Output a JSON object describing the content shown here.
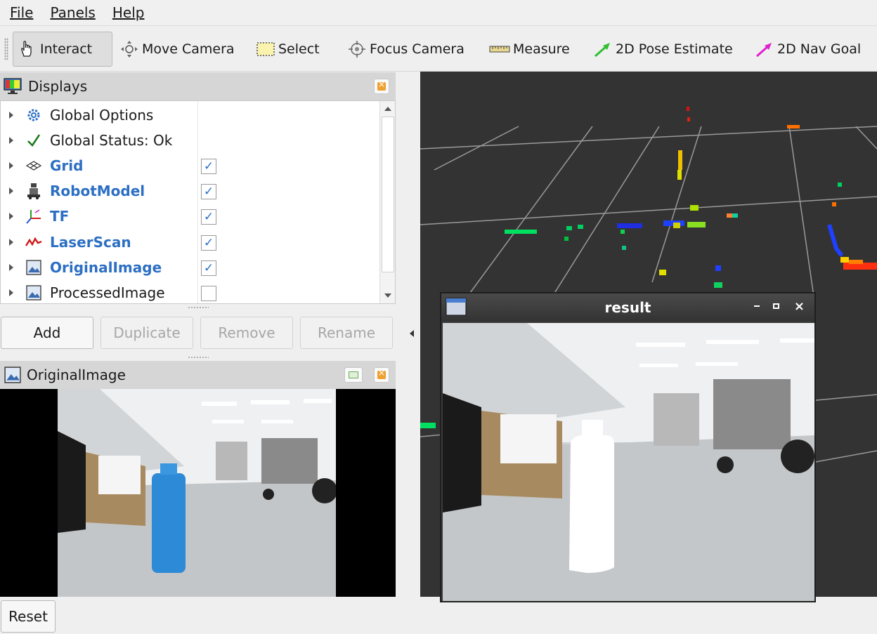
{
  "menubar": {
    "items": [
      "File",
      "Panels",
      "Help"
    ]
  },
  "toolbar": {
    "tools": [
      {
        "label": "Interact",
        "icon": "hand-pointer-icon",
        "active": true
      },
      {
        "label": "Move Camera",
        "icon": "move-camera-icon"
      },
      {
        "label": "Select",
        "icon": "select-box-icon"
      },
      {
        "label": "Focus Camera",
        "icon": "focus-camera-icon"
      },
      {
        "label": "Measure",
        "icon": "ruler-icon"
      },
      {
        "label": "2D Pose Estimate",
        "icon": "green-arrow-icon"
      },
      {
        "label": "2D Nav Goal",
        "icon": "magenta-arrow-icon"
      }
    ]
  },
  "displays": {
    "title": "Displays",
    "items": [
      {
        "label": "Global Options",
        "icon": "gear-icon",
        "highlight": false,
        "checkbox": null
      },
      {
        "label": "Global Status: Ok",
        "icon": "check-icon",
        "highlight": false,
        "checkbox": null
      },
      {
        "label": "Grid",
        "icon": "grid-icon",
        "highlight": true,
        "checkbox": true
      },
      {
        "label": "RobotModel",
        "icon": "robot-icon",
        "highlight": true,
        "checkbox": true
      },
      {
        "label": "TF",
        "icon": "tf-axes-icon",
        "highlight": true,
        "checkbox": true
      },
      {
        "label": "LaserScan",
        "icon": "laser-icon",
        "highlight": true,
        "checkbox": true
      },
      {
        "label": "OriginalImage",
        "icon": "image-icon",
        "highlight": true,
        "checkbox": true
      },
      {
        "label": "ProcessedImage",
        "icon": "image-icon",
        "highlight": false,
        "checkbox": false
      }
    ],
    "buttons": {
      "add": "Add",
      "duplicate": "Duplicate",
      "remove": "Remove",
      "rename": "Rename"
    }
  },
  "image_panel": {
    "title": "OriginalImage"
  },
  "result_window": {
    "title": "result"
  },
  "footer": {
    "reset": "Reset"
  },
  "colors": {
    "accent_blue": "#2c6fc4",
    "view_bg": "#333333",
    "panel_head": "#d6d6d6"
  }
}
